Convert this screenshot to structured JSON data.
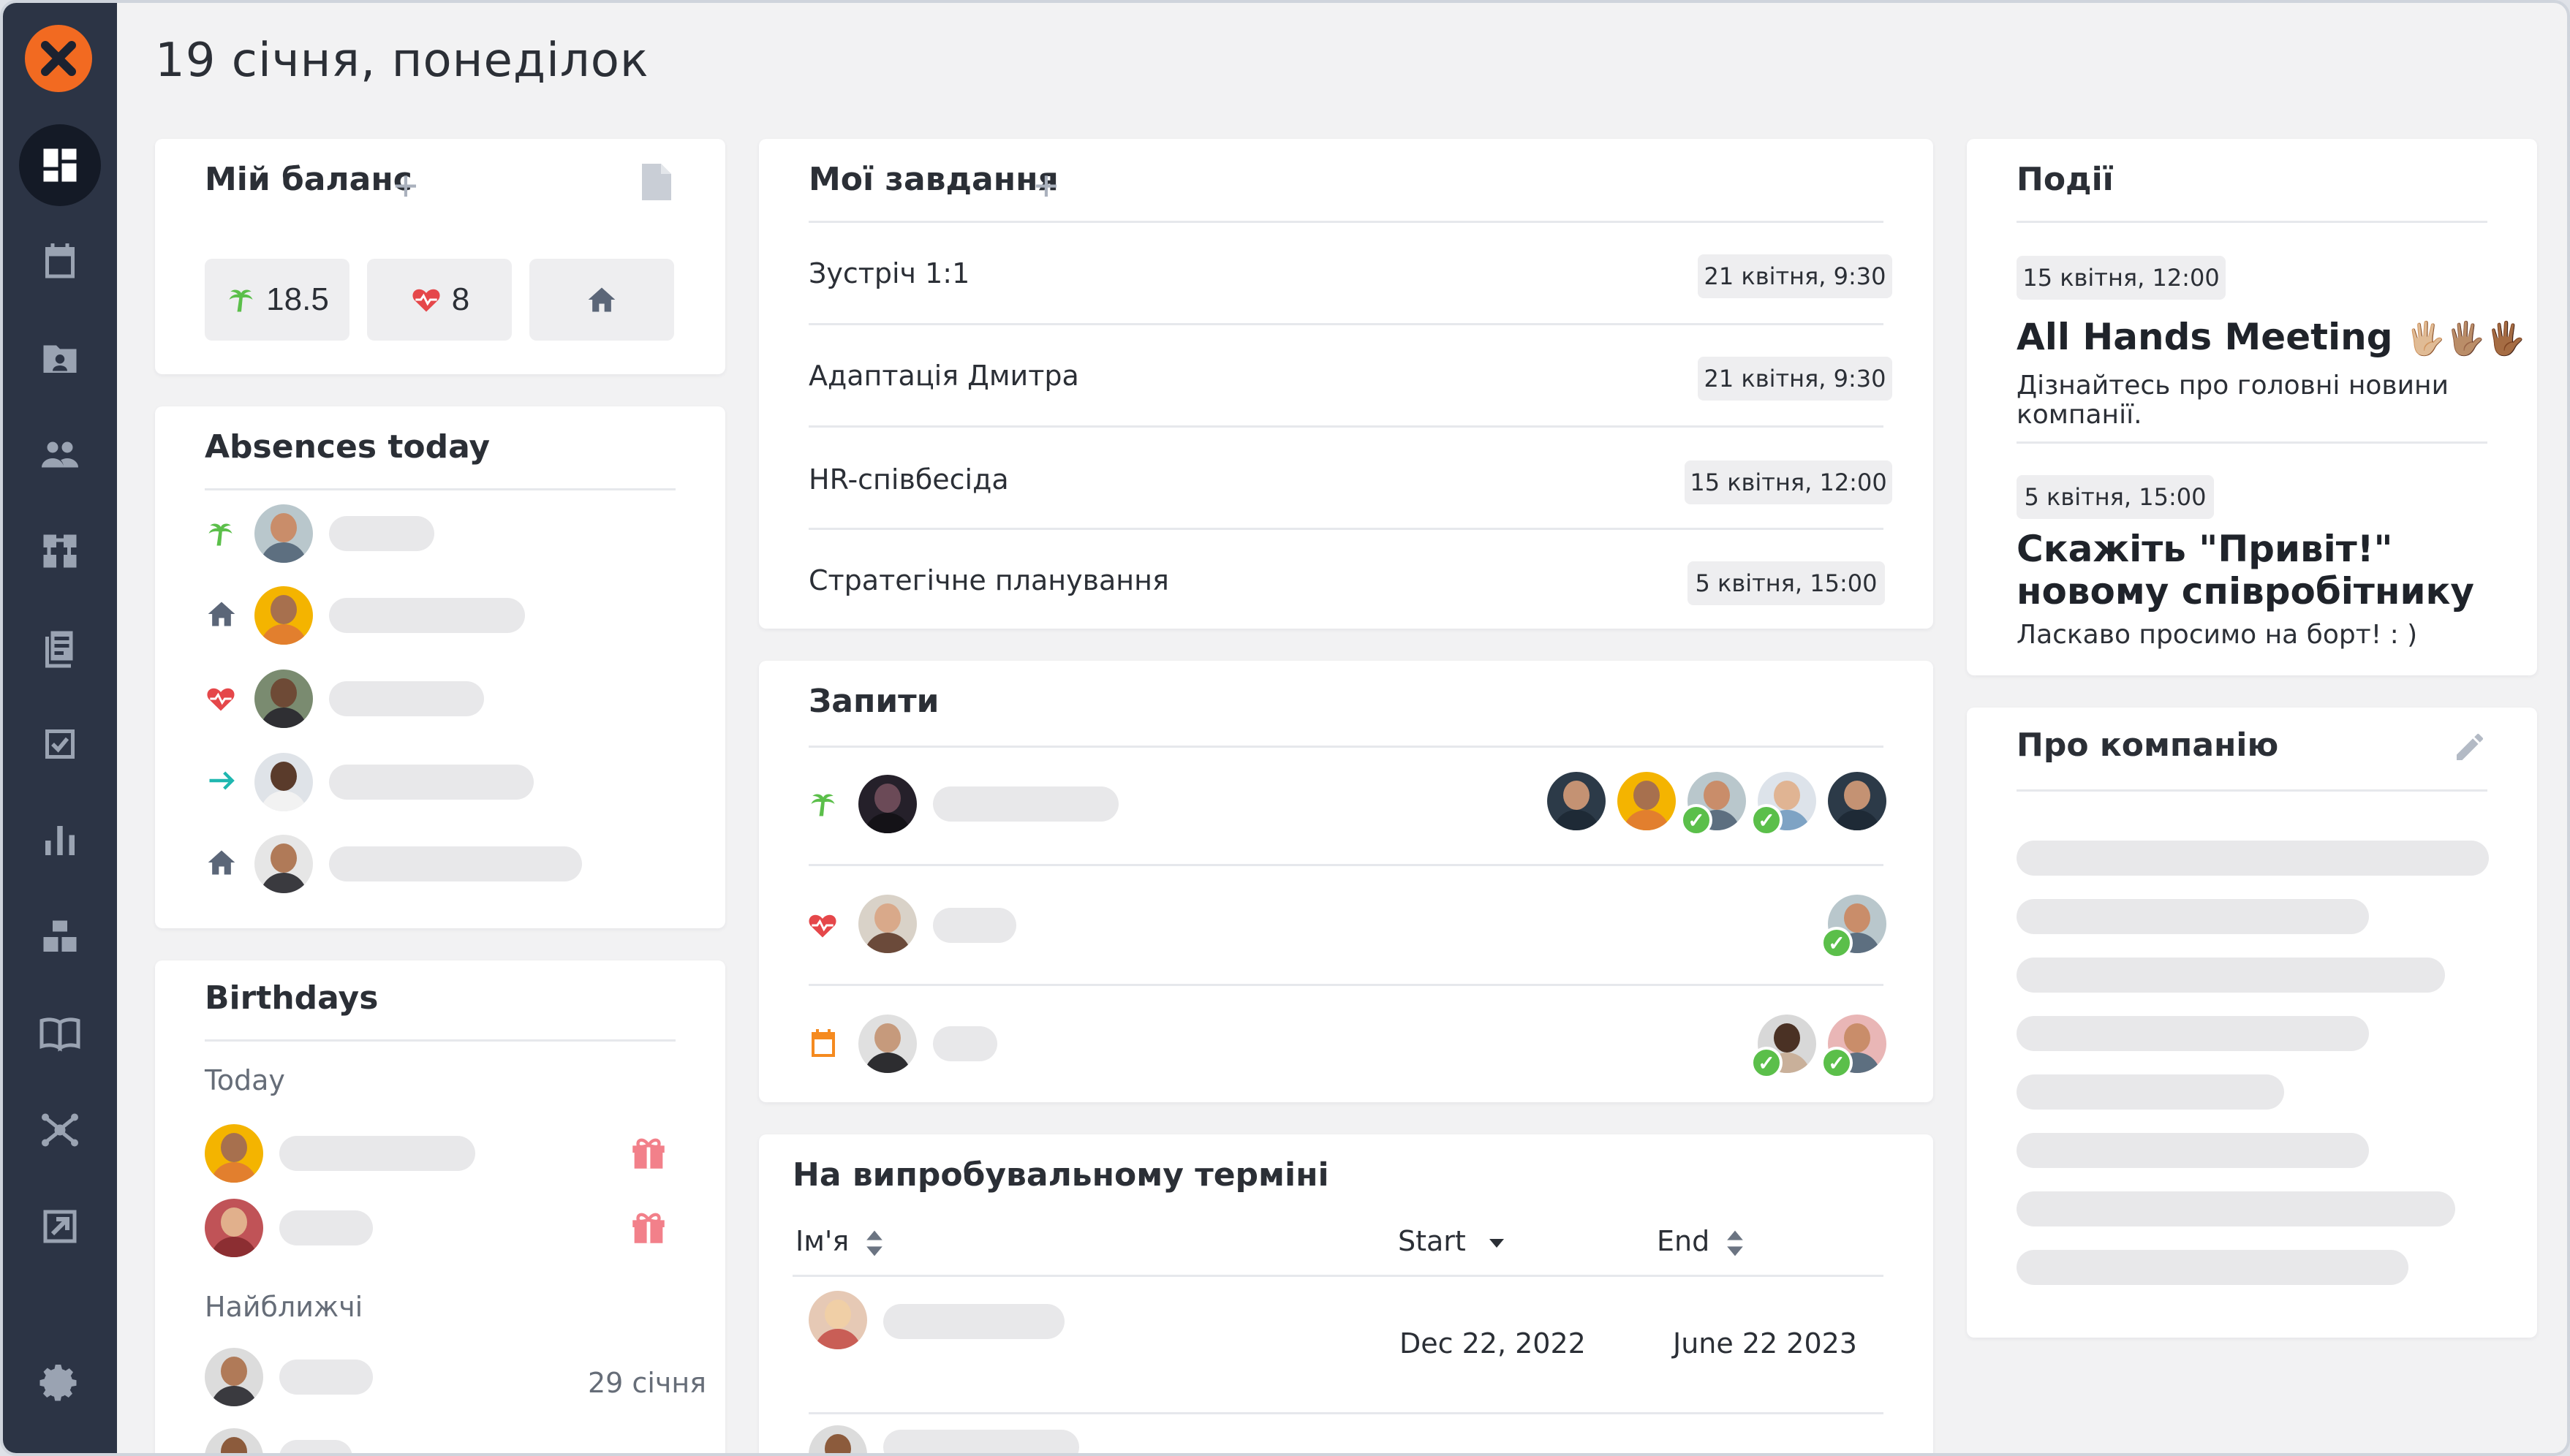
{
  "header": {
    "title": "19 січня, понеділок"
  },
  "sidebar": {
    "items": [
      {
        "icon": "dashboard-icon",
        "active": true
      },
      {
        "icon": "calendar-icon"
      },
      {
        "icon": "profile-folder-icon"
      },
      {
        "icon": "people-icon"
      },
      {
        "icon": "org-structure-icon"
      },
      {
        "icon": "documents-icon"
      },
      {
        "icon": "tasks-check-icon"
      },
      {
        "icon": "reports-chart-icon"
      },
      {
        "icon": "inventory-boxes-icon"
      },
      {
        "icon": "knowledge-book-icon"
      },
      {
        "icon": "integrations-hub-icon"
      },
      {
        "icon": "external-link-icon"
      },
      {
        "icon": "gear-icon"
      }
    ]
  },
  "balance": {
    "title": "Мій баланс",
    "vacation_value": "18.5",
    "sick_value": "8"
  },
  "absences": {
    "title": "Absences today"
  },
  "birthdays": {
    "title": "Birthdays",
    "today_label": "Today",
    "upcoming_label": "Найближчі",
    "upcoming_date": "29 січня"
  },
  "tasks": {
    "title": "Мої завдання",
    "items": [
      {
        "label": "Зустріч 1:1",
        "date": "21 квітня, 9:30"
      },
      {
        "label": "Адаптація Дмитра",
        "date": "21 квітня, 9:30"
      },
      {
        "label": "HR-співбесіда",
        "date": "15 квітня, 12:00"
      },
      {
        "label": "Стратегічне планування",
        "date": "5 квітня, 15:00"
      }
    ]
  },
  "requests": {
    "title": "Запити"
  },
  "probation": {
    "title": "На випробувальному терміні",
    "columns": {
      "name": "Ім'я",
      "start": "Start",
      "end": "End"
    },
    "rows": [
      {
        "start": "Dec 22, 2022",
        "end": "June 22 2023"
      }
    ]
  },
  "events": {
    "title": "Події",
    "items": [
      {
        "date": "15 квітня, 12:00",
        "title": "All Hands Meeting",
        "emoji": "🖐🏼🖐🏽🖐🏾",
        "desc": "Дізнайтесь про головні новини компанії."
      },
      {
        "date": "5 квітня, 15:00",
        "title": "Скажіть \"Привіт!\" новому співробітнику",
        "desc": "Ласкаво просимо на борт! : )"
      }
    ]
  },
  "about": {
    "title": "Про компанію"
  },
  "colors": {
    "accent": "#f26a21",
    "sidebar": "#2c3445",
    "green": "#5bbf4a",
    "red": "#e5474a",
    "teal": "#1fb7b0",
    "orange": "#f58a1f"
  }
}
